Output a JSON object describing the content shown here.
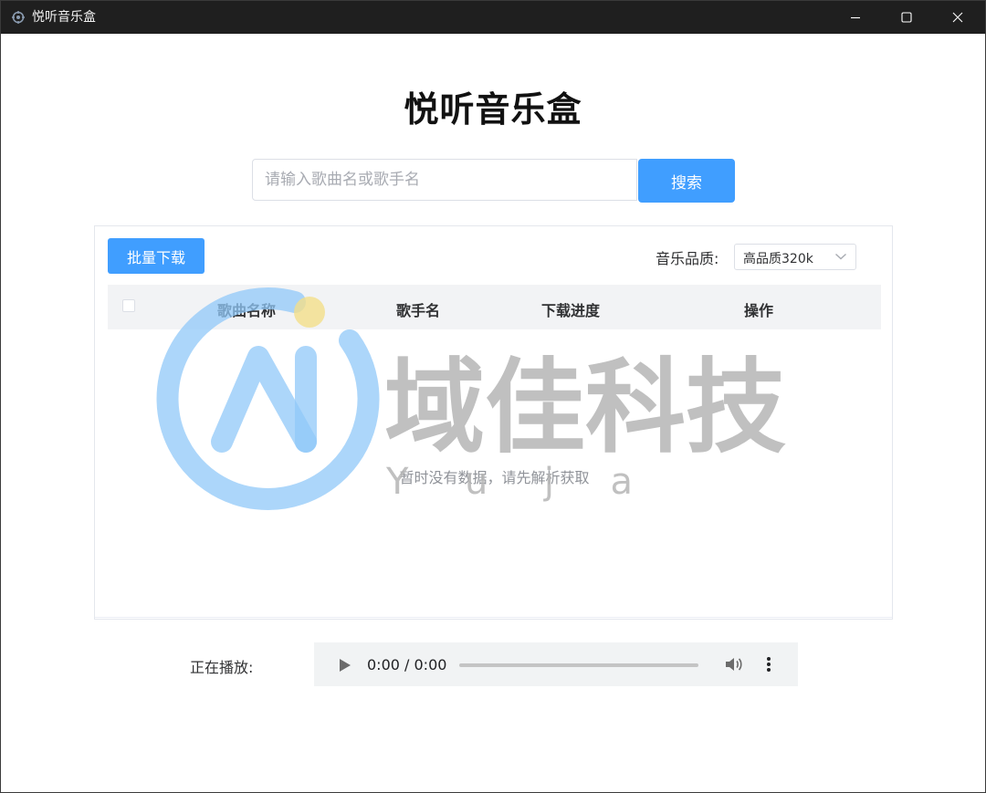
{
  "window": {
    "title": "悦听音乐盒"
  },
  "page": {
    "title": "悦听音乐盒"
  },
  "search": {
    "placeholder": "请输入歌曲名或歌手名",
    "value": "",
    "button_label": "搜索"
  },
  "toolbar": {
    "batch_download_label": "批量下载",
    "quality_label": "音乐品质:",
    "quality_value": "高品质320k"
  },
  "table": {
    "columns": [
      "歌曲名称",
      "歌手名",
      "下载进度",
      "操作"
    ],
    "rows": [],
    "empty_text": "暂时没有数据，请先解析获取"
  },
  "player": {
    "label": "正在播放:",
    "time": "0:00 / 0:00"
  },
  "watermark": {
    "brand": "域佳科技",
    "latin": "Y u j a"
  },
  "colors": {
    "primary": "#409eff",
    "titlebar": "#1f1f1f",
    "watermark_blue": "#90c8f8",
    "watermark_gray": "#b5b5b5"
  },
  "icons": {
    "app": "app-icon",
    "minimize": "minimize-icon",
    "maximize": "maximize-icon",
    "close": "close-icon",
    "select": "chevron-down-icon",
    "play": "play-icon",
    "volume": "volume-icon",
    "more": "more-vertical-icon"
  }
}
